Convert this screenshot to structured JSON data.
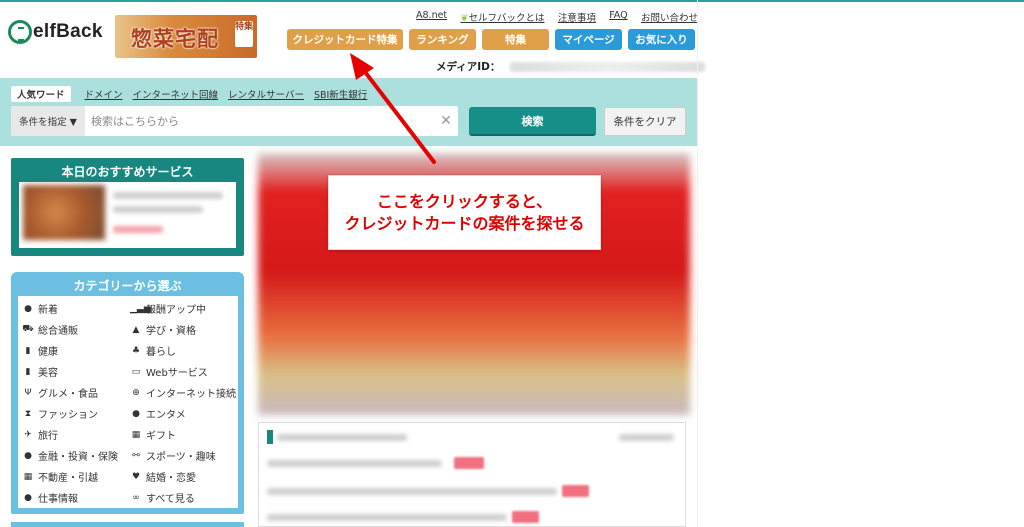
{
  "header": {
    "logo_text": "elfBack",
    "banner_text": "惣菜宅配",
    "banner_badge": "特集",
    "top_links": [
      "A8.net",
      "セルフバックとは",
      "注意事項",
      "FAQ",
      "お問い合わせ"
    ],
    "nav_buttons": [
      {
        "label": "クレジットカード特集",
        "color": "#e0a04a"
      },
      {
        "label": "ランキング",
        "color": "#e0a04a"
      },
      {
        "label": "特集",
        "color": "#e0a04a"
      },
      {
        "label": "マイページ",
        "color": "#2a9ad8"
      },
      {
        "label": "お気に入り",
        "color": "#2a9ad8"
      }
    ],
    "media_id_label": "メディアID："
  },
  "search": {
    "popular_label": "人気ワード",
    "popular_words": [
      "ドメイン",
      "インターネット回線",
      "レンタルサーバー",
      "SBI新生銀行"
    ],
    "condition_label": "条件を指定 ▼",
    "placeholder": "検索はこちらから",
    "search_button": "検索",
    "clear_button": "条件をクリア"
  },
  "sidebar": {
    "recommended_title": "本日のおすすめサービス",
    "categories_title": "カテゴリーから選ぶ",
    "categories": [
      {
        "label": "新着",
        "icon": "speech-bubble-icon"
      },
      {
        "label": "報酬アップ中",
        "icon": "bar-chart-icon"
      },
      {
        "label": "総合通販",
        "icon": "cart-icon"
      },
      {
        "label": "学び・資格",
        "icon": "graduation-cap-icon"
      },
      {
        "label": "健康",
        "icon": "bottle-icon"
      },
      {
        "label": "暮らし",
        "icon": "lamp-icon"
      },
      {
        "label": "美容",
        "icon": "lipstick-icon"
      },
      {
        "label": "Webサービス",
        "icon": "monitor-icon"
      },
      {
        "label": "グルメ・食品",
        "icon": "cutlery-icon"
      },
      {
        "label": "インターネット接続",
        "icon": "globe-icon"
      },
      {
        "label": "ファッション",
        "icon": "dress-icon"
      },
      {
        "label": "エンタメ",
        "icon": "camera-icon"
      },
      {
        "label": "旅行",
        "icon": "airplane-icon"
      },
      {
        "label": "ギフト",
        "icon": "gift-icon"
      },
      {
        "label": "金融・投資・保険",
        "icon": "money-bag-icon"
      },
      {
        "label": "スポーツ・趣味",
        "icon": "dumbbell-icon"
      },
      {
        "label": "不動産・引越",
        "icon": "building-icon"
      },
      {
        "label": "結婚・恋愛",
        "icon": "heart-icon"
      },
      {
        "label": "仕事情報",
        "icon": "person-icon"
      },
      {
        "label": "すべて見る",
        "icon": "binoculars-icon"
      }
    ]
  },
  "callout": {
    "line1": "ここをクリックすると、",
    "line2": "クレジットカードの案件を探せる"
  },
  "colors": {
    "teal": "#18877f",
    "search_band": "#ace0de",
    "category_blue": "#6cbfe0",
    "annotation_red": "#e00000"
  }
}
